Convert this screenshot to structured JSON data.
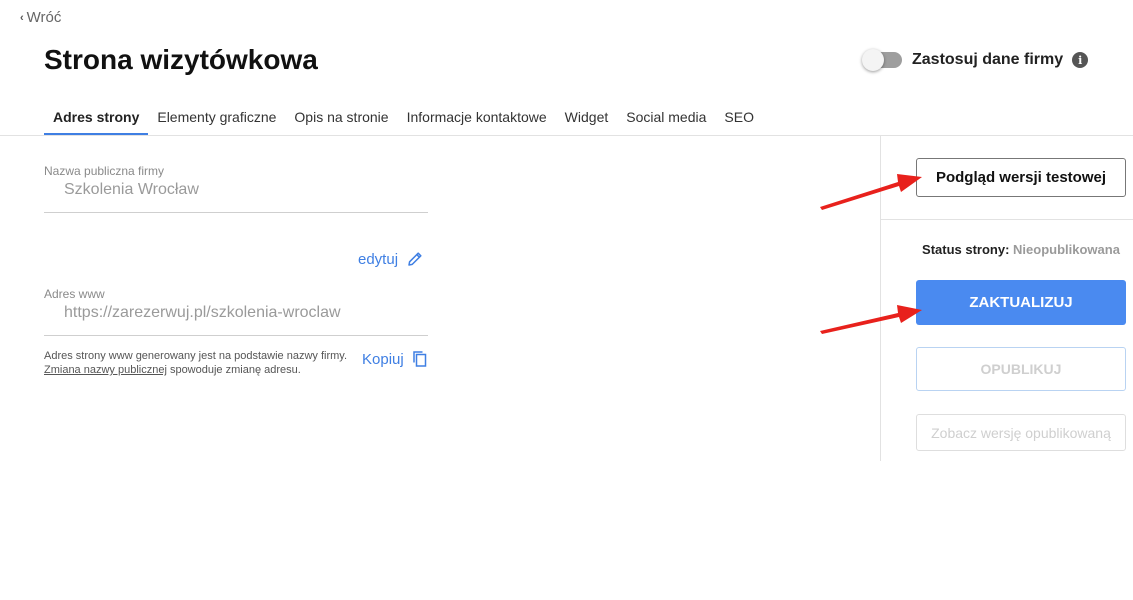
{
  "nav": {
    "back_label": "Wróć"
  },
  "header": {
    "title": "Strona wizytówkowa",
    "toggle_label": "Zastosuj dane firmy",
    "toggle_on": false,
    "info_glyph": "i"
  },
  "tabs": [
    {
      "label": "Adres strony",
      "active": true
    },
    {
      "label": "Elementy graficzne",
      "active": false
    },
    {
      "label": "Opis na stronie",
      "active": false
    },
    {
      "label": "Informacje kontaktowe",
      "active": false
    },
    {
      "label": "Widget",
      "active": false
    },
    {
      "label": "Social media",
      "active": false
    },
    {
      "label": "SEO",
      "active": false
    }
  ],
  "form": {
    "company_name": {
      "label": "Nazwa publiczna firmy",
      "value": "Szkolenia Wrocław"
    },
    "edit_label": "edytuj",
    "www": {
      "label": "Adres www",
      "value": "https://zarezerwuj.pl/szkolenia-wroclaw"
    },
    "hint_line1": "Adres strony www generowany jest na podstawie nazwy firmy.",
    "hint_link": "Zmiana nazwy publicznej",
    "hint_rest": " spowoduje zmianę adresu.",
    "copy_label": "Kopiuj"
  },
  "sidebar": {
    "preview_button": "Podgląd wersji testowej",
    "status_label": "Status strony: ",
    "status_value": "Nieopublikowana",
    "update_button": "ZAKTUALIZUJ",
    "publish_button": "OPUBLIKUJ",
    "view_published_button": "Zobacz wersję opublikowaną"
  },
  "colors": {
    "accent": "#4a8af0",
    "arrow": "#e8211c"
  }
}
